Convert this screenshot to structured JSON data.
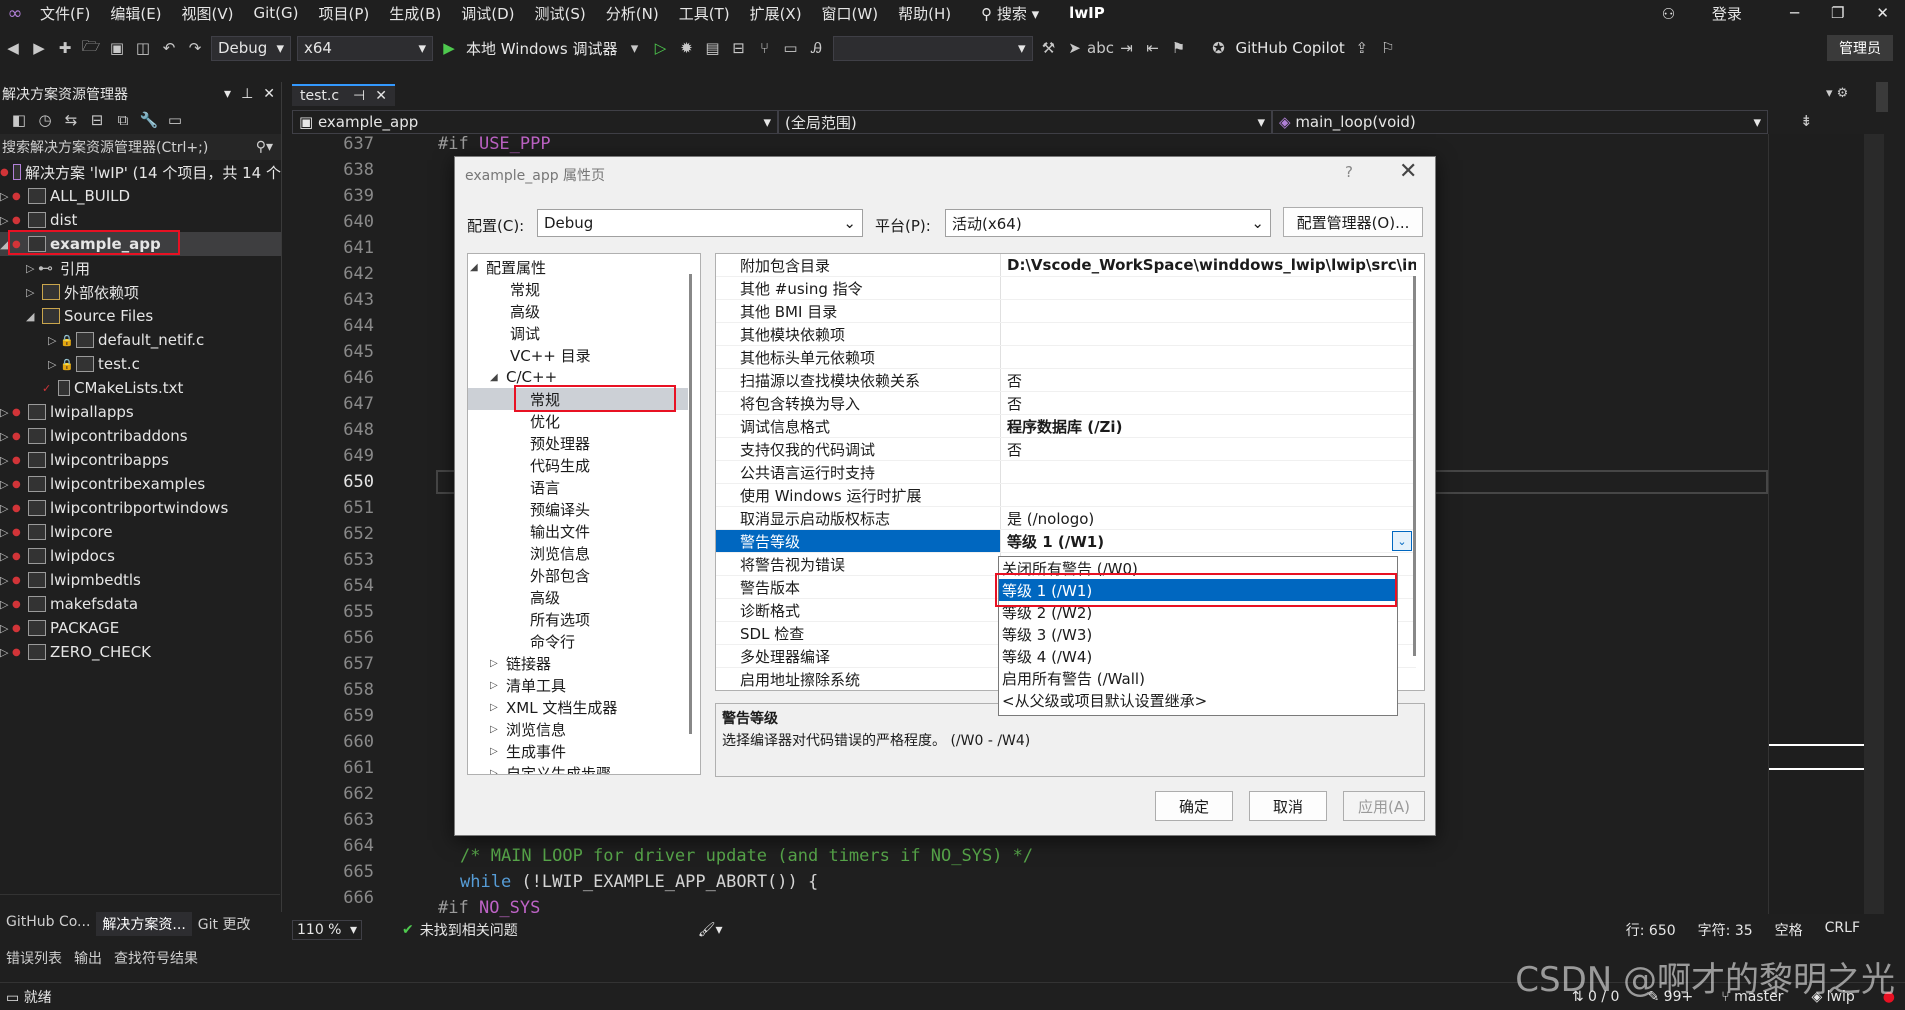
{
  "menu": {
    "items": [
      "文件(F)",
      "编辑(E)",
      "视图(V)",
      "Git(G)",
      "项目(P)",
      "生成(B)",
      "调试(D)",
      "测试(S)",
      "分析(N)",
      "工具(T)",
      "扩展(X)",
      "窗口(W)",
      "帮助(H)"
    ],
    "search": "搜索",
    "project": "lwIP",
    "login": "登录"
  },
  "toolbar": {
    "config": "Debug",
    "platform": "x64",
    "run": "本地 Windows 调试器",
    "copilot": "GitHub Copilot",
    "admin": "管理员"
  },
  "solution": {
    "title": "解决方案资源管理器",
    "search_placeholder": "搜索解决方案资源管理器(Ctrl+;)",
    "root": "解决方案 'lwIP' (14 个项目，共 14 个",
    "items": [
      {
        "label": "ALL_BUILD"
      },
      {
        "label": "dist"
      },
      {
        "label": "example_app"
      },
      {
        "label": "引用"
      },
      {
        "label": "外部依赖项"
      },
      {
        "label": "Source Files"
      },
      {
        "label": "default_netif.c"
      },
      {
        "label": "test.c"
      },
      {
        "label": "CMakeLists.txt"
      },
      {
        "label": "lwipallapps"
      },
      {
        "label": "lwipcontribaddons"
      },
      {
        "label": "lwipcontribapps"
      },
      {
        "label": "lwipcontribexamples"
      },
      {
        "label": "lwipcontribportwindows"
      },
      {
        "label": "lwipcore"
      },
      {
        "label": "lwipdocs"
      },
      {
        "label": "lwipmbedtls"
      },
      {
        "label": "makefsdata"
      },
      {
        "label": "PACKAGE"
      },
      {
        "label": "ZERO_CHECK"
      }
    ],
    "tabs": [
      "GitHub Co...",
      "解决方案资...",
      "Git 更改"
    ],
    "bottom_tabs": [
      "错误列表",
      "输出",
      "查找符号结果"
    ]
  },
  "editor": {
    "tab": "test.c",
    "nav_file": "example_app",
    "nav_scope": "(全局范围)",
    "nav_func": "main_loop(void)",
    "line_numbers": [
      "637",
      "638",
      "639",
      "640",
      "641",
      "642",
      "643",
      "644",
      "645",
      "646",
      "647",
      "648",
      "649",
      "650",
      "651",
      "652",
      "653",
      "654",
      "655",
      "656",
      "657",
      "658",
      "659",
      "660",
      "661",
      "662",
      "663",
      "664",
      "665",
      "666"
    ],
    "code_637_a": "#if ",
    "code_637_b": "USE_PPP",
    "code_664": "/* MAIN LOOP for driver update (and timers if NO_SYS) */",
    "code_665_a": "while",
    "code_665_b": " (!LWIP_EXAMPLE_APP_ABORT()) {",
    "code_666_a": "#if ",
    "code_666_b": "NO_SYS",
    "zoom": "110 %",
    "issues": "未找到相关问题",
    "line": "行: 650",
    "char": "字符: 35",
    "spaces": "空格",
    "eol": "CRLF"
  },
  "status": {
    "ready": "就绪",
    "sync": "0 / 0",
    "count": "99+",
    "branch": "master",
    "repo": "lwip"
  },
  "watermark": "CSDN @啊才的黎明之光",
  "dialog": {
    "title": "example_app 属性页",
    "help": "?",
    "config_label": "配置(C):",
    "config_value": "Debug",
    "platform_label": "平台(P):",
    "platform_value": "活动(x64)",
    "config_manager": "配置管理器(O)...",
    "tree": [
      {
        "label": "配置属性",
        "toggle": "◢"
      },
      {
        "label": "常规",
        "toggle": ""
      },
      {
        "label": "高级",
        "toggle": ""
      },
      {
        "label": "调试",
        "toggle": ""
      },
      {
        "label": "VC++ 目录",
        "toggle": ""
      },
      {
        "label": "C/C++",
        "toggle": "◢"
      },
      {
        "label": "常规",
        "toggle": ""
      },
      {
        "label": "优化",
        "toggle": ""
      },
      {
        "label": "预处理器",
        "toggle": ""
      },
      {
        "label": "代码生成",
        "toggle": ""
      },
      {
        "label": "语言",
        "toggle": ""
      },
      {
        "label": "预编译头",
        "toggle": ""
      },
      {
        "label": "输出文件",
        "toggle": ""
      },
      {
        "label": "浏览信息",
        "toggle": ""
      },
      {
        "label": "外部包含",
        "toggle": ""
      },
      {
        "label": "高级",
        "toggle": ""
      },
      {
        "label": "所有选项",
        "toggle": ""
      },
      {
        "label": "命令行",
        "toggle": ""
      },
      {
        "label": "链接器",
        "toggle": "▷"
      },
      {
        "label": "清单工具",
        "toggle": "▷"
      },
      {
        "label": "XML 文档生成器",
        "toggle": "▷"
      },
      {
        "label": "浏览信息",
        "toggle": "▷"
      },
      {
        "label": "生成事件",
        "toggle": "▷"
      },
      {
        "label": "自定义生成步骤",
        "toggle": "▷"
      }
    ],
    "props": [
      {
        "name": "附加包含目录",
        "value": "D:\\Vscode_WorkSpace\\winddows_lwip\\lwip\\src\\inclu"
      },
      {
        "name": "其他 #using 指令",
        "value": ""
      },
      {
        "name": "其他 BMI 目录",
        "value": ""
      },
      {
        "name": "其他模块依赖项",
        "value": ""
      },
      {
        "name": "其他标头单元依赖项",
        "value": ""
      },
      {
        "name": "扫描源以查找模块依赖关系",
        "value": "否"
      },
      {
        "name": "将包含转换为导入",
        "value": "否"
      },
      {
        "name": "调试信息格式",
        "value": "程序数据库 (/Zi)"
      },
      {
        "name": "支持仅我的代码调试",
        "value": "否"
      },
      {
        "name": "公共语言运行时支持",
        "value": ""
      },
      {
        "name": "使用 Windows 运行时扩展",
        "value": ""
      },
      {
        "name": "取消显示启动版权标志",
        "value": "是 (/nologo)"
      },
      {
        "name": "警告等级",
        "value": "等级 1 (/W1)"
      },
      {
        "name": "将警告视为错误",
        "value": ""
      },
      {
        "name": "警告版本",
        "value": ""
      },
      {
        "name": "诊断格式",
        "value": ""
      },
      {
        "name": "SDL 检查",
        "value": ""
      },
      {
        "name": "多处理器编译",
        "value": ""
      },
      {
        "name": "启用地址擦除系统",
        "value": ""
      }
    ],
    "dropdown": [
      "关闭所有警告 (/W0)",
      "等级 1 (/W1)",
      "等级 2 (/W2)",
      "等级 3 (/W3)",
      "等级 4 (/W4)",
      "启用所有警告 (/Wall)",
      "<从父级或项目默认设置继承>"
    ],
    "desc_title": "警告等级",
    "desc_text": "选择编译器对代码错误的严格程度。     (/W0 - /W4)",
    "ok": "确定",
    "cancel": "取消",
    "apply": "应用(A)"
  },
  "colors": {
    "accent": "#0067c0",
    "highlight_box": "#e81123",
    "keyword": "#569cd6",
    "comment": "#57a64a",
    "macro": "#bd63c5"
  }
}
